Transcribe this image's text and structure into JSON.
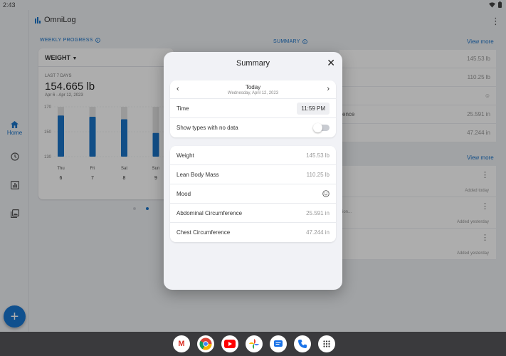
{
  "status": {
    "time": "2:43"
  },
  "app": {
    "name": "OmniLog"
  },
  "nav": {
    "home_label": "Home"
  },
  "weekly": {
    "section_title": "WEEKLY PROGRESS",
    "metric": "WEIGHT",
    "period": "LAST 7 DAYS",
    "value": "154.665 lb",
    "range": "Apr 6 - Apr 12, 2023"
  },
  "chart_data": {
    "type": "bar",
    "categories": [
      "Thu",
      "Fri",
      "Sat",
      "Sun"
    ],
    "day_numbers": [
      "6",
      "7",
      "8",
      "9"
    ],
    "values": [
      163,
      162,
      160,
      149
    ],
    "ylim": [
      130,
      170
    ],
    "yticks": [
      "170",
      "150",
      "130"
    ]
  },
  "summary_bg": {
    "section_title": "SUMMARY",
    "view_more": "View more",
    "view_more_2": "View more",
    "rows": [
      {
        "label": "",
        "value": "145.53 lb"
      },
      {
        "label": "",
        "value": "110.25 lb"
      },
      {
        "label": "",
        "value": ""
      },
      {
        "label": "ence",
        "value": "25.591 in"
      },
      {
        "label": "",
        "value": "47.244 in"
      }
    ],
    "entries": [
      {
        "note": "",
        "added": "Added today"
      },
      {
        "note": "ion...",
        "added": "Added yesterday"
      },
      {
        "note": "",
        "added": "Added yesterday"
      }
    ]
  },
  "dialog": {
    "title": "Summary",
    "date_main": "Today",
    "date_sub": "Wednesday, April 12, 2023",
    "time_label": "Time",
    "time_value": "11:59 PM",
    "show_types_label": "Show types with no data",
    "rows": [
      {
        "label": "Weight",
        "value": "145.53 lb"
      },
      {
        "label": "Lean Body Mass",
        "value": "110.25 lb"
      },
      {
        "label": "Mood",
        "value": ""
      },
      {
        "label": "Abdominal Circumference",
        "value": "25.591 in"
      },
      {
        "label": "Chest Circumference",
        "value": "47.244 in"
      }
    ]
  },
  "dock": {
    "apps": [
      "Gmail",
      "Chrome",
      "YouTube",
      "Photos",
      "Messages",
      "Phone",
      "App drawer"
    ]
  },
  "colors": {
    "accent": "#1976d2",
    "bar": "#1a73c8",
    "bar_track": "#e3e3e3"
  }
}
